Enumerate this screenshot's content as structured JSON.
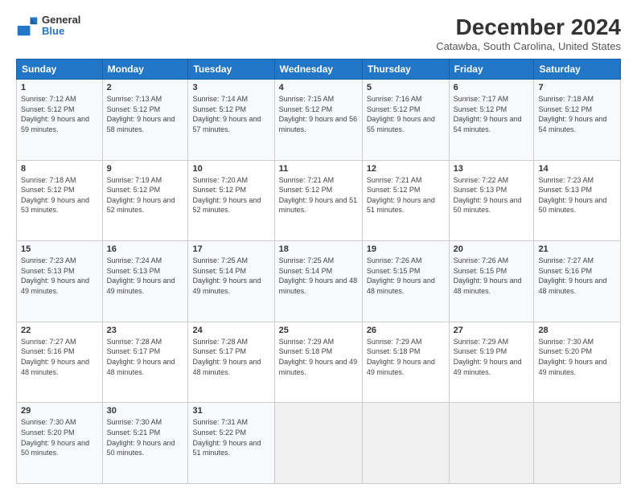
{
  "header": {
    "logo_general": "General",
    "logo_blue": "Blue",
    "main_title": "December 2024",
    "subtitle": "Catawba, South Carolina, United States"
  },
  "days_of_week": [
    "Sunday",
    "Monday",
    "Tuesday",
    "Wednesday",
    "Thursday",
    "Friday",
    "Saturday"
  ],
  "weeks": [
    [
      {
        "day": "1",
        "sunrise": "Sunrise: 7:12 AM",
        "sunset": "Sunset: 5:12 PM",
        "daylight": "Daylight: 9 hours and 59 minutes."
      },
      {
        "day": "2",
        "sunrise": "Sunrise: 7:13 AM",
        "sunset": "Sunset: 5:12 PM",
        "daylight": "Daylight: 9 hours and 58 minutes."
      },
      {
        "day": "3",
        "sunrise": "Sunrise: 7:14 AM",
        "sunset": "Sunset: 5:12 PM",
        "daylight": "Daylight: 9 hours and 57 minutes."
      },
      {
        "day": "4",
        "sunrise": "Sunrise: 7:15 AM",
        "sunset": "Sunset: 5:12 PM",
        "daylight": "Daylight: 9 hours and 56 minutes."
      },
      {
        "day": "5",
        "sunrise": "Sunrise: 7:16 AM",
        "sunset": "Sunset: 5:12 PM",
        "daylight": "Daylight: 9 hours and 55 minutes."
      },
      {
        "day": "6",
        "sunrise": "Sunrise: 7:17 AM",
        "sunset": "Sunset: 5:12 PM",
        "daylight": "Daylight: 9 hours and 54 minutes."
      },
      {
        "day": "7",
        "sunrise": "Sunrise: 7:18 AM",
        "sunset": "Sunset: 5:12 PM",
        "daylight": "Daylight: 9 hours and 54 minutes."
      }
    ],
    [
      {
        "day": "8",
        "sunrise": "Sunrise: 7:18 AM",
        "sunset": "Sunset: 5:12 PM",
        "daylight": "Daylight: 9 hours and 53 minutes."
      },
      {
        "day": "9",
        "sunrise": "Sunrise: 7:19 AM",
        "sunset": "Sunset: 5:12 PM",
        "daylight": "Daylight: 9 hours and 52 minutes."
      },
      {
        "day": "10",
        "sunrise": "Sunrise: 7:20 AM",
        "sunset": "Sunset: 5:12 PM",
        "daylight": "Daylight: 9 hours and 52 minutes."
      },
      {
        "day": "11",
        "sunrise": "Sunrise: 7:21 AM",
        "sunset": "Sunset: 5:12 PM",
        "daylight": "Daylight: 9 hours and 51 minutes."
      },
      {
        "day": "12",
        "sunrise": "Sunrise: 7:21 AM",
        "sunset": "Sunset: 5:12 PM",
        "daylight": "Daylight: 9 hours and 51 minutes."
      },
      {
        "day": "13",
        "sunrise": "Sunrise: 7:22 AM",
        "sunset": "Sunset: 5:13 PM",
        "daylight": "Daylight: 9 hours and 50 minutes."
      },
      {
        "day": "14",
        "sunrise": "Sunrise: 7:23 AM",
        "sunset": "Sunset: 5:13 PM",
        "daylight": "Daylight: 9 hours and 50 minutes."
      }
    ],
    [
      {
        "day": "15",
        "sunrise": "Sunrise: 7:23 AM",
        "sunset": "Sunset: 5:13 PM",
        "daylight": "Daylight: 9 hours and 49 minutes."
      },
      {
        "day": "16",
        "sunrise": "Sunrise: 7:24 AM",
        "sunset": "Sunset: 5:13 PM",
        "daylight": "Daylight: 9 hours and 49 minutes."
      },
      {
        "day": "17",
        "sunrise": "Sunrise: 7:25 AM",
        "sunset": "Sunset: 5:14 PM",
        "daylight": "Daylight: 9 hours and 49 minutes."
      },
      {
        "day": "18",
        "sunrise": "Sunrise: 7:25 AM",
        "sunset": "Sunset: 5:14 PM",
        "daylight": "Daylight: 9 hours and 48 minutes."
      },
      {
        "day": "19",
        "sunrise": "Sunrise: 7:26 AM",
        "sunset": "Sunset: 5:15 PM",
        "daylight": "Daylight: 9 hours and 48 minutes."
      },
      {
        "day": "20",
        "sunrise": "Sunrise: 7:26 AM",
        "sunset": "Sunset: 5:15 PM",
        "daylight": "Daylight: 9 hours and 48 minutes."
      },
      {
        "day": "21",
        "sunrise": "Sunrise: 7:27 AM",
        "sunset": "Sunset: 5:16 PM",
        "daylight": "Daylight: 9 hours and 48 minutes."
      }
    ],
    [
      {
        "day": "22",
        "sunrise": "Sunrise: 7:27 AM",
        "sunset": "Sunset: 5:16 PM",
        "daylight": "Daylight: 9 hours and 48 minutes."
      },
      {
        "day": "23",
        "sunrise": "Sunrise: 7:28 AM",
        "sunset": "Sunset: 5:17 PM",
        "daylight": "Daylight: 9 hours and 48 minutes."
      },
      {
        "day": "24",
        "sunrise": "Sunrise: 7:28 AM",
        "sunset": "Sunset: 5:17 PM",
        "daylight": "Daylight: 9 hours and 48 minutes."
      },
      {
        "day": "25",
        "sunrise": "Sunrise: 7:29 AM",
        "sunset": "Sunset: 5:18 PM",
        "daylight": "Daylight: 9 hours and 49 minutes."
      },
      {
        "day": "26",
        "sunrise": "Sunrise: 7:29 AM",
        "sunset": "Sunset: 5:18 PM",
        "daylight": "Daylight: 9 hours and 49 minutes."
      },
      {
        "day": "27",
        "sunrise": "Sunrise: 7:29 AM",
        "sunset": "Sunset: 5:19 PM",
        "daylight": "Daylight: 9 hours and 49 minutes."
      },
      {
        "day": "28",
        "sunrise": "Sunrise: 7:30 AM",
        "sunset": "Sunset: 5:20 PM",
        "daylight": "Daylight: 9 hours and 49 minutes."
      }
    ],
    [
      {
        "day": "29",
        "sunrise": "Sunrise: 7:30 AM",
        "sunset": "Sunset: 5:20 PM",
        "daylight": "Daylight: 9 hours and 50 minutes."
      },
      {
        "day": "30",
        "sunrise": "Sunrise: 7:30 AM",
        "sunset": "Sunset: 5:21 PM",
        "daylight": "Daylight: 9 hours and 50 minutes."
      },
      {
        "day": "31",
        "sunrise": "Sunrise: 7:31 AM",
        "sunset": "Sunset: 5:22 PM",
        "daylight": "Daylight: 9 hours and 51 minutes."
      },
      null,
      null,
      null,
      null
    ]
  ]
}
